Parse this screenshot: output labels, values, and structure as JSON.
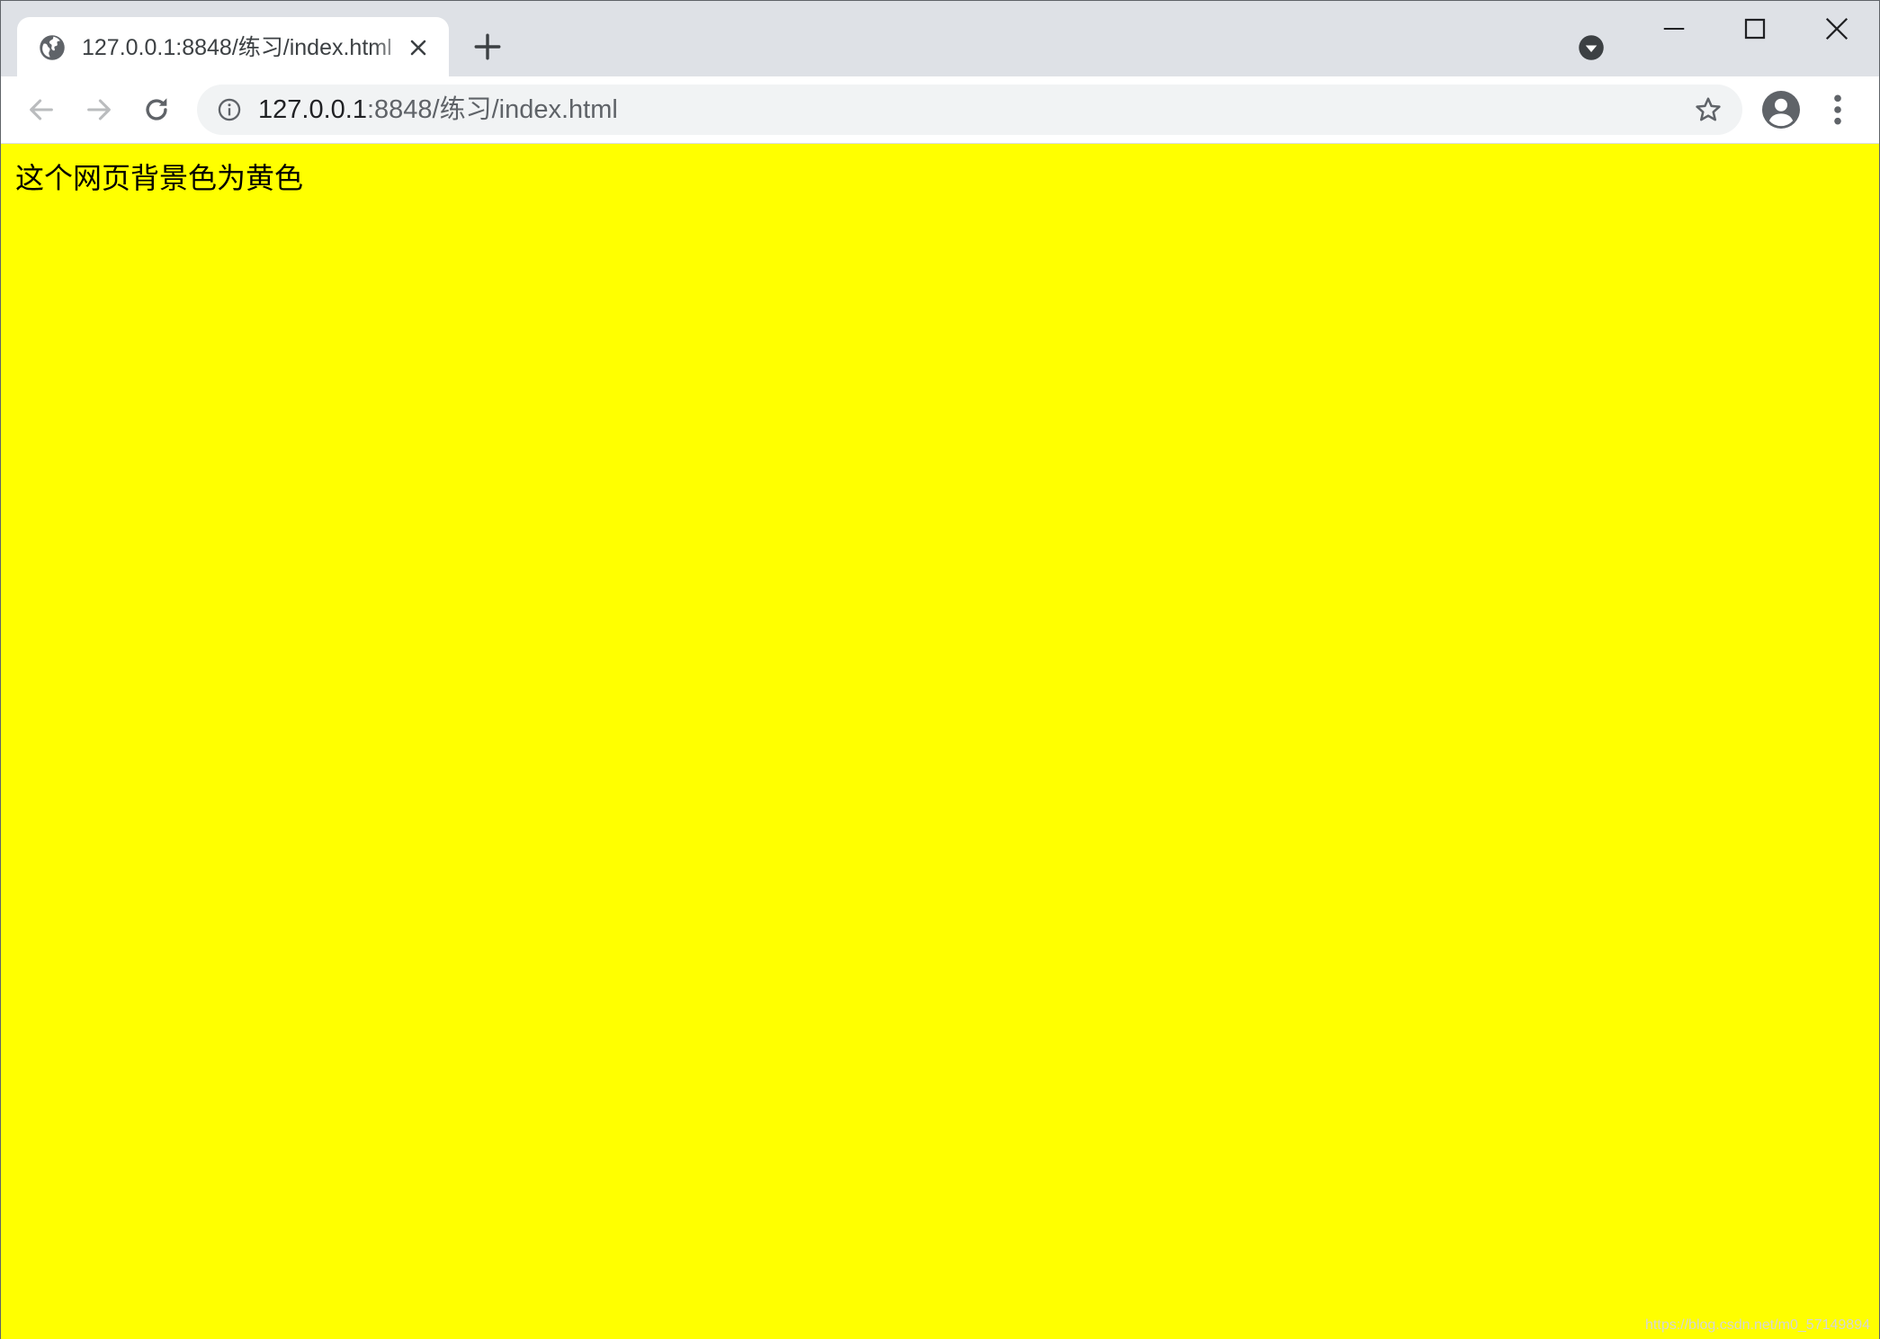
{
  "browser": {
    "tab": {
      "title": "127.0.0.1:8848/练习/index.html",
      "favicon": "globe-icon",
      "close_icon": "close-icon"
    },
    "new_tab_icon": "plus-icon",
    "tab_search_icon": "tab-search-icon",
    "window_controls": {
      "minimize_icon": "minimize-icon",
      "maximize_icon": "maximize-icon",
      "close_icon": "window-close-icon"
    },
    "toolbar": {
      "back_icon": "back-arrow-icon",
      "forward_icon": "forward-arrow-icon",
      "reload_icon": "reload-icon",
      "site_info_icon": "info-icon",
      "url_host": "127.0.0.1",
      "url_rest": ":8848/练习/index.html",
      "bookmark_icon": "star-icon",
      "profile_icon": "account-icon",
      "menu_icon": "more-vert-icon"
    }
  },
  "page": {
    "background_color": "#ffff00",
    "text": "这个网页背景色为黄色"
  },
  "watermark": "https://blog.csdn.net/m0_57149894"
}
